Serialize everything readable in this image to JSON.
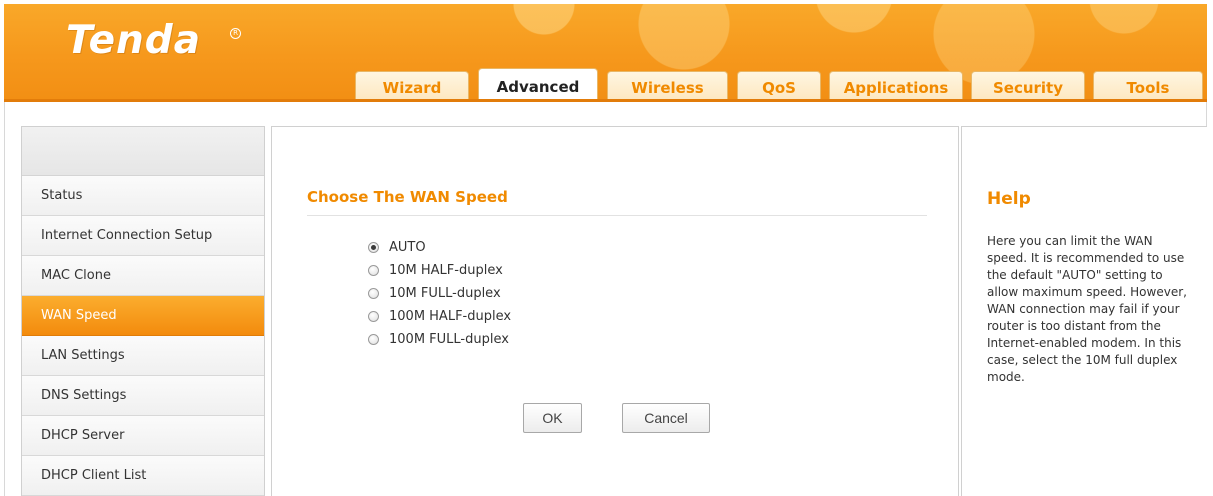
{
  "brand": {
    "logo_text": "Tenda",
    "registered_mark": "R",
    "accent_color": "#f6981c"
  },
  "tabs": [
    {
      "label": "Wizard",
      "active": false
    },
    {
      "label": "Advanced",
      "active": true
    },
    {
      "label": "Wireless",
      "active": false
    },
    {
      "label": "QoS",
      "active": false
    },
    {
      "label": "Applications",
      "active": false
    },
    {
      "label": "Security",
      "active": false
    },
    {
      "label": "Tools",
      "active": false
    }
  ],
  "sidebar": {
    "items": [
      {
        "label": "Status",
        "active": false
      },
      {
        "label": "Internet Connection Setup",
        "active": false
      },
      {
        "label": "MAC Clone",
        "active": false
      },
      {
        "label": "WAN Speed",
        "active": true
      },
      {
        "label": "LAN Settings",
        "active": false
      },
      {
        "label": "DNS Settings",
        "active": false
      },
      {
        "label": "DHCP Server",
        "active": false
      },
      {
        "label": "DHCP Client List",
        "active": false
      }
    ]
  },
  "main": {
    "title": "Choose The WAN Speed",
    "options": [
      {
        "label": "AUTO",
        "checked": true
      },
      {
        "label": "10M HALF-duplex",
        "checked": false
      },
      {
        "label": "10M FULL-duplex",
        "checked": false
      },
      {
        "label": "100M HALF-duplex",
        "checked": false
      },
      {
        "label": "100M FULL-duplex",
        "checked": false
      }
    ],
    "ok_label": "OK",
    "cancel_label": "Cancel"
  },
  "help": {
    "title": "Help",
    "text": "Here you can limit the WAN speed. It is recommended to use the default \"AUTO\" setting to allow maximum speed. However, WAN connection may fail if your router is too distant from the Internet-enabled modem. In this case, select the 10M full duplex mode."
  }
}
